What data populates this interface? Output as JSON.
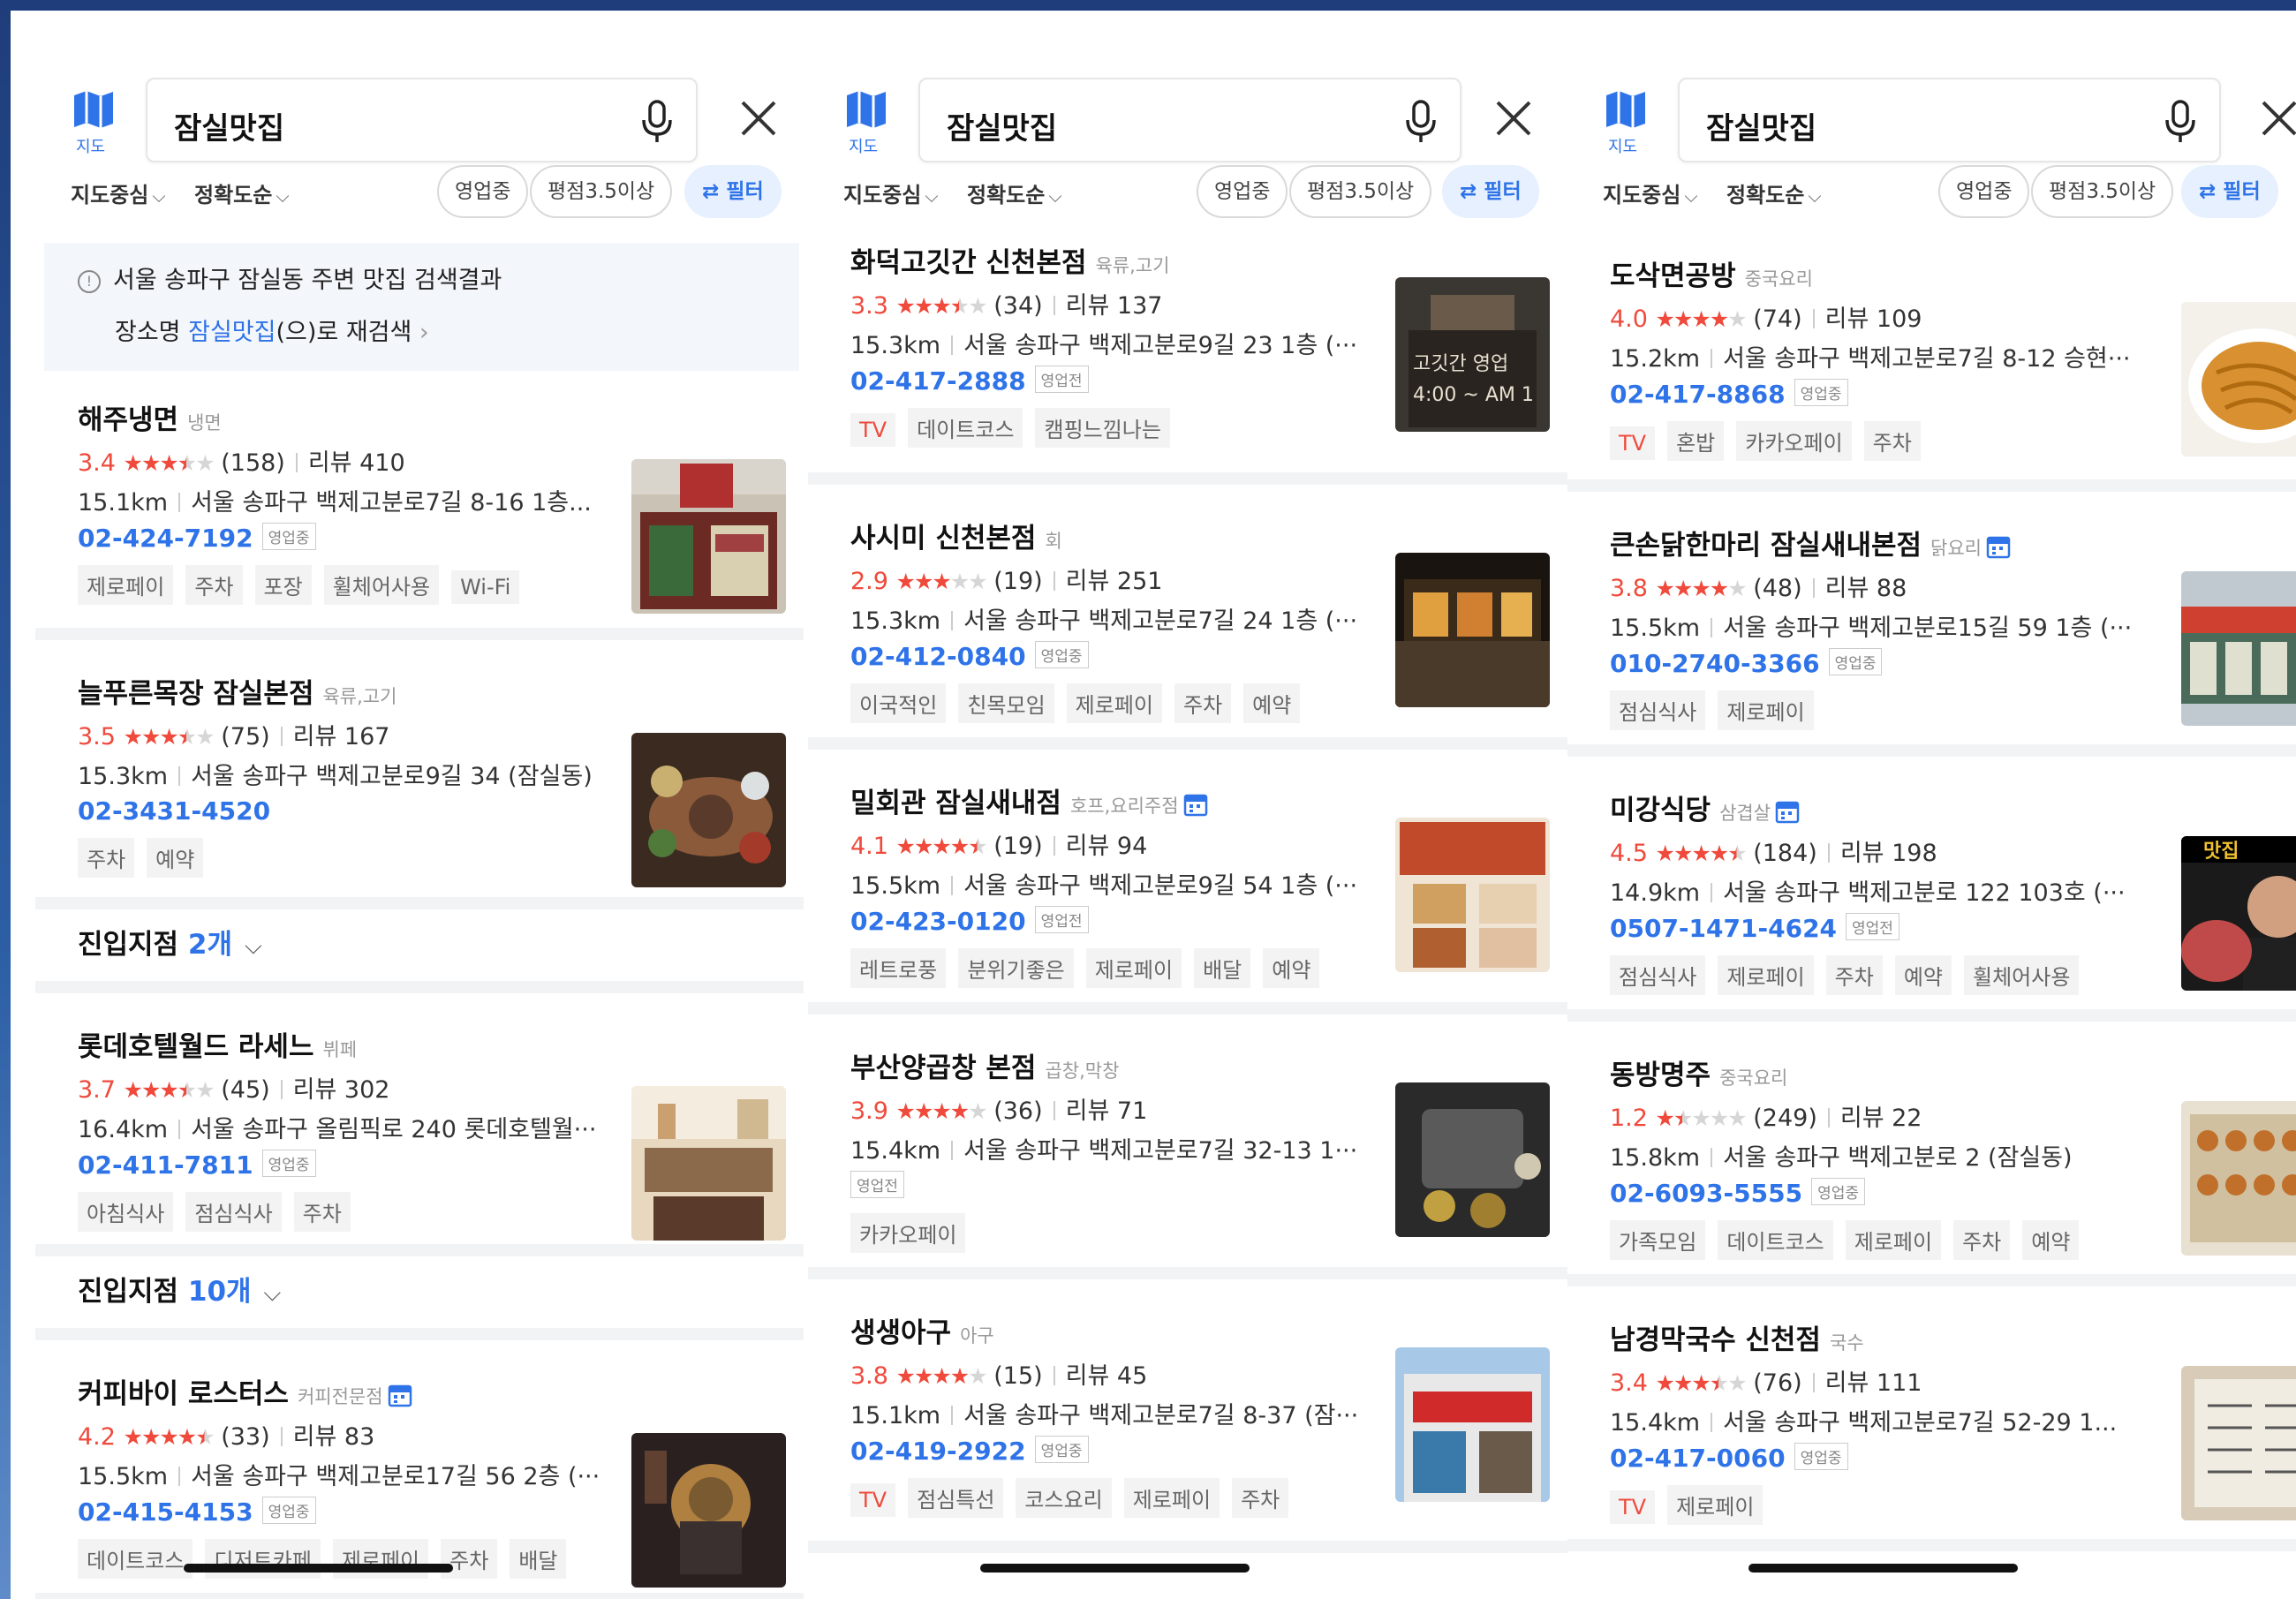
{
  "map_label": "지도",
  "search_query": "잠실맛집",
  "filters": {
    "sort1": "지도중심",
    "sort2": "정확도순",
    "chip_open": "영업중",
    "chip_rating": "평점3.5이상",
    "chip_filter": "필터"
  },
  "notice": {
    "line1": "서울 송파구 잠실동 주변 맛집 검색결과",
    "line2_prefix": "장소명 ",
    "line2_keyword": "잠실맛집",
    "line2_suffix": "(으)로 재검색"
  },
  "panels": [
    {
      "items": [
        {
          "name": "해주냉면",
          "category": "냉면",
          "rating": "3.4",
          "stars": 3.5,
          "count": "(158)",
          "reviews": "리뷰 410",
          "distance": "15.1km",
          "address": "서울 송파구 백제고분로7길 8-16 1층...",
          "phone": "02-424-7192",
          "status": "영업중",
          "tags": [
            "제로페이",
            "주차",
            "포장",
            "휠체어사용",
            "Wi-Fi"
          ],
          "tv": false,
          "image": "storefront",
          "reserve": false
        },
        {
          "name": "늘푸른목장 잠실본점",
          "category": "육류,고기",
          "rating": "3.5",
          "stars": 3.5,
          "count": "(75)",
          "reviews": "리뷰 167",
          "distance": "15.3km",
          "address": "서울 송파구 백제고분로9길 34 (잠실동)",
          "phone": "02-3431-4520",
          "status": "",
          "tags": [
            "주차",
            "예약"
          ],
          "tv": false,
          "image": "bbq",
          "reserve": false,
          "branch": {
            "label": "진입지점 ",
            "count": "2개"
          }
        },
        {
          "name": "롯데호텔월드 라세느",
          "category": "뷔페",
          "rating": "3.7",
          "stars": 3.5,
          "count": "(45)",
          "reviews": "리뷰 302",
          "distance": "16.4km",
          "address": "서울 송파구 올림픽로 240 롯데호텔월···",
          "phone": "02-411-7811",
          "status": "영업중",
          "tags": [
            "아침식사",
            "점심식사",
            "주차"
          ],
          "tv": false,
          "image": "buffet",
          "reserve": false,
          "branch": {
            "label": "진입지점 ",
            "count": "10개"
          }
        },
        {
          "name": "커피바이 로스터스",
          "category": "커피전문점",
          "rating": "4.2",
          "stars": 4.5,
          "count": "(33)",
          "reviews": "리뷰 83",
          "distance": "15.5km",
          "address": "서울 송파구 백제고분로17길 56 2층 (···",
          "phone": "02-415-4153",
          "status": "영업중",
          "tags": [
            "데이트코스",
            "디저트카페",
            "제로페이",
            "주차",
            "배달"
          ],
          "tv": false,
          "image": "coffee",
          "reserve": true
        }
      ]
    },
    {
      "items": [
        {
          "name": "화덕고깃간 신천본점",
          "category": "육류,고기",
          "rating": "3.3",
          "stars": 3.5,
          "count": "(34)",
          "reviews": "리뷰 137",
          "distance": "15.3km",
          "address": "서울 송파구 백제고분로9길 23 1층 (···",
          "phone": "02-417-2888",
          "status": "영업전",
          "tags": [
            "데이트코스",
            "캠핑느낌나는"
          ],
          "tv": true,
          "image": "sign",
          "reserve": false
        },
        {
          "name": "사시미 신천본점",
          "category": "회",
          "rating": "2.9",
          "stars": 3,
          "count": "(19)",
          "reviews": "리뷰 251",
          "distance": "15.3km",
          "address": "서울 송파구 백제고분로7길 24 1층 (···",
          "phone": "02-412-0840",
          "status": "영업중",
          "tags": [
            "이국적인",
            "친목모임",
            "제로페이",
            "주차",
            "예약"
          ],
          "tv": false,
          "image": "night",
          "reserve": false
        },
        {
          "name": "밀회관 잠실새내점",
          "category": "호프,요리주점",
          "rating": "4.1",
          "stars": 4.5,
          "count": "(19)",
          "reviews": "리뷰 94",
          "distance": "15.5km",
          "address": "서울 송파구 백제고분로9길 54 1층 (···",
          "phone": "02-423-0120",
          "status": "영업전",
          "tags": [
            "레트로풍",
            "분위기좋은",
            "제로페이",
            "배달",
            "예약"
          ],
          "tv": false,
          "image": "menu",
          "reserve": true
        },
        {
          "name": "부산양곱창 본점",
          "category": "곱창,막창",
          "rating": "3.9",
          "stars": 4,
          "count": "(36)",
          "reviews": "리뷰 71",
          "distance": "15.4km",
          "address": "서울 송파구 백제고분로7길 32-13 1···",
          "phone": "",
          "status": "영업전",
          "tags": [
            "카카오페이"
          ],
          "tv": false,
          "image": "grill",
          "reserve": false
        },
        {
          "name": "생생아구",
          "category": "아구",
          "rating": "3.8",
          "stars": 4,
          "count": "(15)",
          "reviews": "리뷰 45",
          "distance": "15.1km",
          "address": "서울 송파구 백제고분로7길 8-37 (잠···",
          "phone": "02-419-2922",
          "status": "영업중",
          "tags": [
            "점심특선",
            "코스요리",
            "제로페이",
            "주차"
          ],
          "tv": true,
          "image": "building",
          "reserve": false
        }
      ]
    },
    {
      "items": [
        {
          "name": "도삭면공방",
          "category": "중국요리",
          "rating": "4.0",
          "stars": 4,
          "count": "(74)",
          "reviews": "리뷰 109",
          "distance": "15.2km",
          "address": "서울 송파구 백제고분로7길 8-12 승현···",
          "phone": "02-417-8868",
          "status": "영업중",
          "tags": [
            "혼밥",
            "카카오페이",
            "주차"
          ],
          "tv": true,
          "image": "noodle",
          "reserve": false
        },
        {
          "name": "큰손닭한마리 잠실새내본점",
          "category": "닭요리",
          "rating": "3.8",
          "stars": 4,
          "count": "(48)",
          "reviews": "리뷰 88",
          "distance": "15.5km",
          "address": "서울 송파구 백제고분로15길 59 1층 (···",
          "phone": "010-2740-3366",
          "status": "영업중",
          "tags": [
            "점심식사",
            "제로페이"
          ],
          "tv": false,
          "image": "shopfront",
          "reserve": true
        },
        {
          "name": "미강식당",
          "category": "삼겹살",
          "rating": "4.5",
          "stars": 4.5,
          "count": "(184)",
          "reviews": "리뷰 198",
          "distance": "14.9km",
          "address": "서울 송파구 백제고분로 122 103호 (···",
          "phone": "0507-1471-4624",
          "status": "영업전",
          "tags": [
            "점심식사",
            "제로페이",
            "주차",
            "예약",
            "휠체어사용"
          ],
          "tv": false,
          "image": "chef",
          "reserve": true
        },
        {
          "name": "동방명주",
          "category": "중국요리",
          "rating": "1.2",
          "stars": 1.5,
          "count": "(249)",
          "reviews": "리뷰 22",
          "distance": "15.8km",
          "address": "서울 송파구 백제고분로 2 (잠실동)",
          "phone": "02-6093-5555",
          "status": "영업중",
          "tags": [
            "가족모임",
            "데이트코스",
            "제로페이",
            "주차",
            "예약"
          ],
          "tv": false,
          "image": "display",
          "reserve": false
        },
        {
          "name": "남경막국수 신천점",
          "category": "국수",
          "rating": "3.4",
          "stars": 3.5,
          "count": "(76)",
          "reviews": "리뷰 111",
          "distance": "15.4km",
          "address": "서울 송파구 백제고분로7길 52-29 1...",
          "phone": "02-417-0060",
          "status": "영업중",
          "tags": [
            "제로페이"
          ],
          "tv": true,
          "image": "menuboard",
          "reserve": false
        }
      ]
    }
  ],
  "colors": {
    "accent": "#2f73e8",
    "rating": "#ef4a3c",
    "border": "#1f3d7a"
  }
}
